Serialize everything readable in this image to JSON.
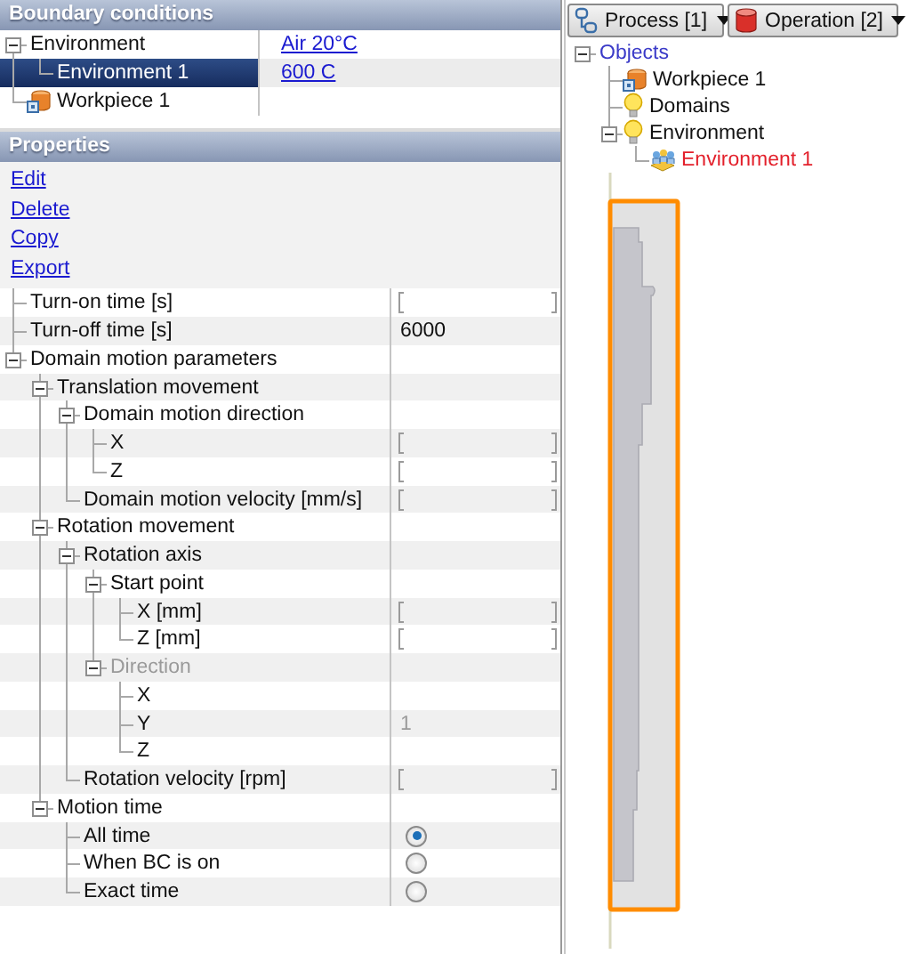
{
  "boundary_conditions": {
    "title": "Boundary conditions",
    "items": [
      {
        "label": "Environment",
        "value": "Air 20°C",
        "selected": false,
        "expanded": true,
        "children": [
          {
            "label": "Environment 1",
            "value": "600 C",
            "selected": true
          }
        ]
      },
      {
        "label": "Workpiece 1",
        "kind": "workpiece",
        "selected": false
      }
    ]
  },
  "properties": {
    "title": "Properties",
    "actions": [
      "Edit",
      "Delete",
      "Copy",
      "Export"
    ],
    "rows": [
      {
        "label": "Turn-on time [s]",
        "kind": "field",
        "disabled": false
      },
      {
        "label": "Turn-off time [s]",
        "kind": "text",
        "value": "6000",
        "disabled": false
      },
      {
        "label": "Domain motion parameters",
        "kind": "group",
        "disabled": false,
        "expanded": true,
        "children": [
          {
            "label": "Translation movement",
            "kind": "group",
            "disabled": false,
            "expanded": true,
            "children": [
              {
                "label": "Domain motion direction",
                "kind": "group",
                "disabled": false,
                "expanded": true,
                "children": [
                  {
                    "label": "X",
                    "kind": "field",
                    "disabled": false
                  },
                  {
                    "label": "Z",
                    "kind": "field",
                    "disabled": false
                  }
                ]
              },
              {
                "label": "Domain motion velocity [mm/s]",
                "kind": "field",
                "disabled": false
              }
            ]
          },
          {
            "label": "Rotation movement",
            "kind": "group",
            "disabled": false,
            "expanded": true,
            "children": [
              {
                "label": "Rotation axis",
                "kind": "group",
                "disabled": false,
                "expanded": true,
                "children": [
                  {
                    "label": "Start point",
                    "kind": "group",
                    "disabled": false,
                    "expanded": true,
                    "children": [
                      {
                        "label": "X [mm]",
                        "kind": "field",
                        "disabled": false
                      },
                      {
                        "label": "Z [mm]",
                        "kind": "field",
                        "disabled": false
                      }
                    ]
                  },
                  {
                    "label": "Direction",
                    "kind": "group",
                    "disabled": true,
                    "expanded": true,
                    "children": [
                      {
                        "label": "X",
                        "kind": "readonly",
                        "disabled": false
                      },
                      {
                        "label": "Y",
                        "kind": "readonly",
                        "value": "1",
                        "disabled": false
                      },
                      {
                        "label": "Z",
                        "kind": "readonly",
                        "disabled": false
                      }
                    ]
                  }
                ]
              },
              {
                "label": "Rotation velocity [rpm]",
                "kind": "field",
                "disabled": false
              }
            ]
          },
          {
            "label": "Motion time",
            "kind": "group",
            "disabled": false,
            "expanded": true,
            "children": [
              {
                "label": "All time",
                "kind": "radio",
                "selected": true,
                "disabled": false
              },
              {
                "label": "When BC is on",
                "kind": "radio",
                "selected": false,
                "disabled": false
              },
              {
                "label": "Exact time",
                "kind": "radio",
                "selected": false,
                "disabled": false
              }
            ]
          }
        ]
      }
    ]
  },
  "object_panel": {
    "process_menu": "Process [1]",
    "operation_menu": "Operation [2]",
    "tree": [
      {
        "label": "Objects",
        "kind": "root",
        "selected": false,
        "expanded": true,
        "children": [
          {
            "label": "Workpiece 1",
            "kind": "workpiece",
            "selected": false
          },
          {
            "label": "Domains",
            "kind": "bulb",
            "selected": false
          },
          {
            "label": "Environment",
            "kind": "bulb",
            "selected": false,
            "expanded": true,
            "children": [
              {
                "label": "Environment 1",
                "kind": "environment",
                "selected": true
              }
            ]
          }
        ]
      }
    ]
  }
}
